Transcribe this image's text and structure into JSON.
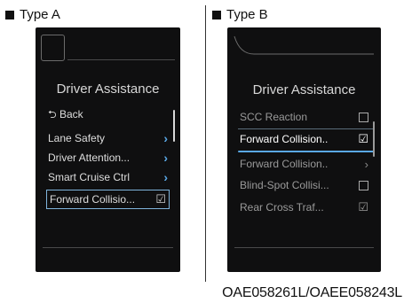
{
  "labels": {
    "type_a": "Type A",
    "type_b": "Type B"
  },
  "caption": "OAE058261L/OAEE058243L",
  "type_a": {
    "title": "Driver Assistance",
    "back": "Back",
    "back_icon": "return-arrow-icon",
    "items": [
      {
        "label": "Lane Safety",
        "indicator": "chevron-right-icon"
      },
      {
        "label": "Driver Attention...",
        "indicator": "chevron-right-icon"
      },
      {
        "label": "Smart Cruise Ctrl",
        "indicator": "chevron-right-icon"
      },
      {
        "label": "Forward Collisio...",
        "indicator": "checked-box-icon",
        "selected": true
      }
    ]
  },
  "type_b": {
    "title": "Driver Assistance",
    "items": [
      {
        "label": "SCC Reaction",
        "indicator": "empty-box-icon"
      },
      {
        "label": "Forward Collision..",
        "indicator": "checked-box-icon",
        "selected": true
      },
      {
        "label": "Forward Collision..",
        "indicator": "chevron-right-icon"
      },
      {
        "label": "Blind-Spot Collisi...",
        "indicator": "empty-box-icon"
      },
      {
        "label": "Rear Cross Traf...",
        "indicator": "checked-box-icon"
      }
    ]
  },
  "colors": {
    "screen": "#0f0f10",
    "accent": "#5aa8e6",
    "text": "#dedede"
  }
}
